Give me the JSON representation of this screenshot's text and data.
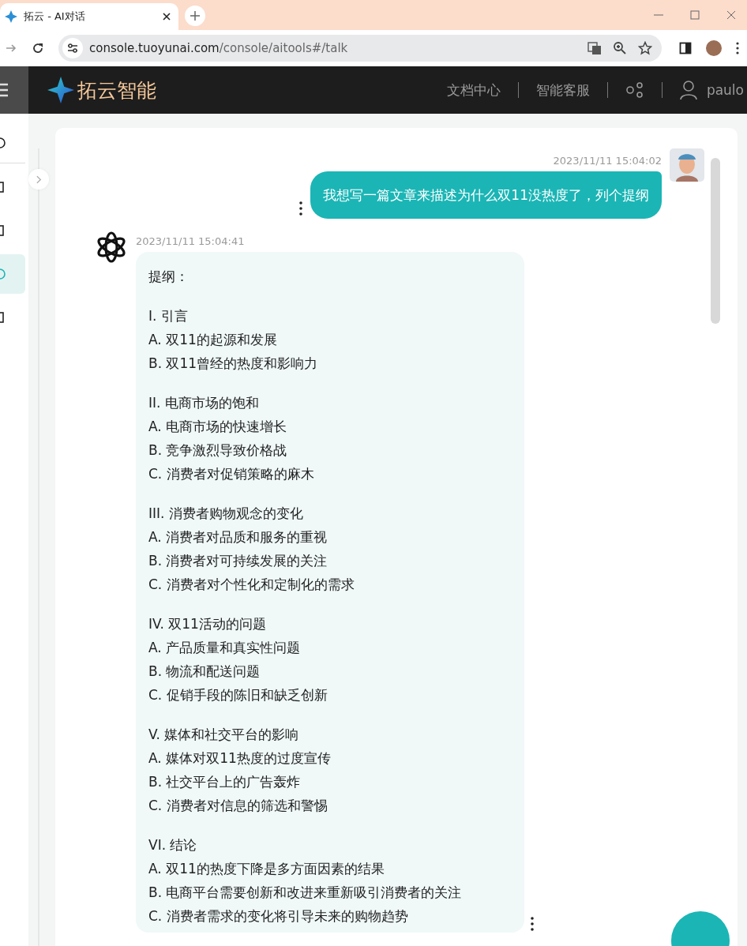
{
  "browser": {
    "tab_title": "拓云 - AI对话",
    "url_host": "console.tuoyunai.com",
    "url_path": "/console/aitools#/talk"
  },
  "header": {
    "brand": "拓云智能",
    "links": [
      "文档中心",
      "智能客服"
    ],
    "user": "paulo"
  },
  "sidebar": {
    "items": [
      {
        "selected": false
      },
      {
        "selected": false
      },
      {
        "selected": false
      },
      {
        "selected": true
      },
      {
        "selected": false
      }
    ]
  },
  "messages": [
    {
      "kind": "user",
      "time": "2023/11/11 15:04:02",
      "text": "我想写一篇文章来描述为什么双11没热度了，列个提纲"
    },
    {
      "kind": "ai",
      "time": "2023/11/11 15:04:41",
      "intro": "提纲：",
      "sections": [
        {
          "heading": "I. 引言",
          "items": [
            "A. 双11的起源和发展",
            "B. 双11曾经的热度和影响力"
          ]
        },
        {
          "heading": "II. 电商市场的饱和",
          "items": [
            "A. 电商市场的快速增长",
            "B. 竞争激烈导致价格战",
            "C. 消费者对促销策略的麻木"
          ]
        },
        {
          "heading": "III. 消费者购物观念的变化",
          "items": [
            "A. 消费者对品质和服务的重视",
            "B. 消费者对可持续发展的关注",
            "C. 消费者对个性化和定制化的需求"
          ]
        },
        {
          "heading": "IV. 双11活动的问题",
          "items": [
            "A. 产品质量和真实性问题",
            "B. 物流和配送问题",
            "C. 促销手段的陈旧和缺乏创新"
          ]
        },
        {
          "heading": "V. 媒体和社交平台的影响",
          "items": [
            "A. 媒体对双11热度的过度宣传",
            "B. 社交平台上的广告轰炸",
            "C. 消费者对信息的筛选和警惕"
          ]
        },
        {
          "heading": "VI. 结论",
          "items": [
            "A. 双11的热度下降是多方面因素的结果",
            "B. 电商平台需要创新和改进来重新吸引消费者的关注",
            "C. 消费者需求的变化将引导未来的购物趋势"
          ]
        }
      ]
    }
  ]
}
